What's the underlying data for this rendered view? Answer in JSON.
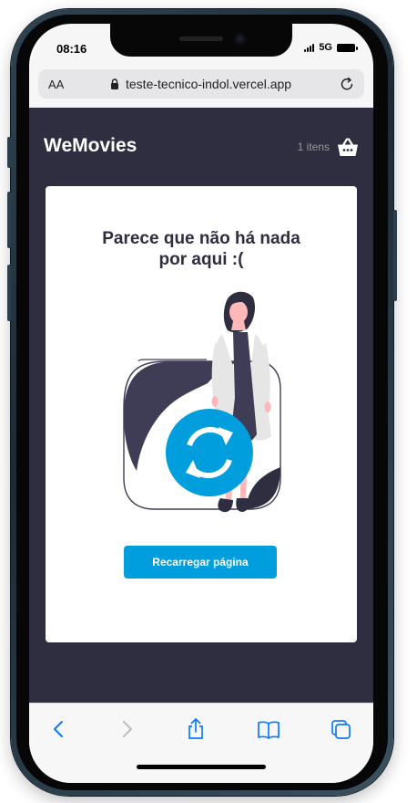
{
  "status_bar": {
    "time": "08:16",
    "network": "5G"
  },
  "browser": {
    "text_size_button": "AA",
    "url": "teste-tecnico-indol.vercel.app",
    "icons": {
      "lock": "lock-icon",
      "reload": "reload-icon"
    }
  },
  "app": {
    "brand": "WeMovies",
    "cart_count": "1 itens",
    "cart_icon": "basket-icon",
    "empty_state": {
      "title": "Parece que não há nada por aqui :(",
      "button_label": "Recarregar página",
      "icon": "refresh-icon"
    }
  },
  "toolbar": {
    "items": [
      "back-icon",
      "forward-icon",
      "share-icon",
      "bookmarks-icon",
      "tabs-icon"
    ]
  },
  "colors": {
    "app_background": "#2f2e41",
    "card_background": "#ffffff",
    "accent": "#009edd",
    "browser_link": "#0a7aff"
  }
}
